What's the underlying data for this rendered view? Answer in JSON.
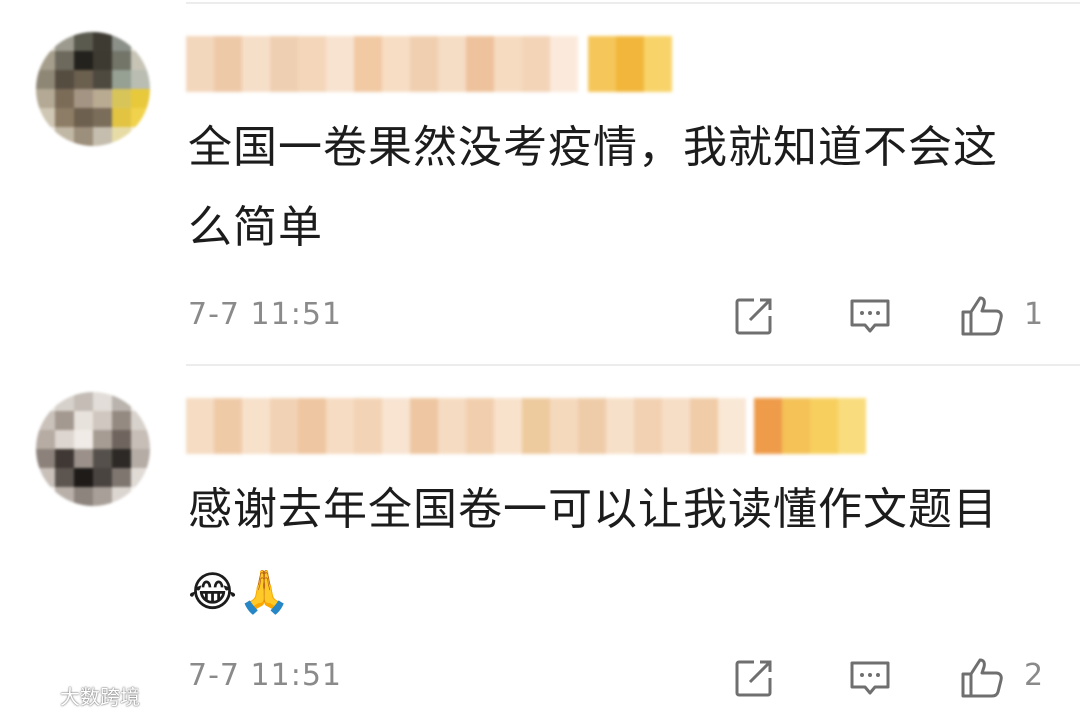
{
  "comments": [
    {
      "text": "全国一卷果然没考疫情，我就知道不会这么简单",
      "emoji": "",
      "timestamp": "7-7 11:51",
      "like_count": "1"
    },
    {
      "text": "感谢去年全国卷一可以让我读懂作文题目",
      "emoji": "😂🙏",
      "timestamp": "7-7 11:51",
      "like_count": "2"
    }
  ],
  "icons": {
    "forward": "share-edit-icon",
    "comment": "comment-bubble-icon",
    "like": "thumbs-up-icon"
  },
  "watermark": {
    "text": "大数跨境"
  },
  "colors": {
    "text": "#1c1c1c",
    "meta": "#8a8a8a",
    "divider": "#ececec"
  }
}
